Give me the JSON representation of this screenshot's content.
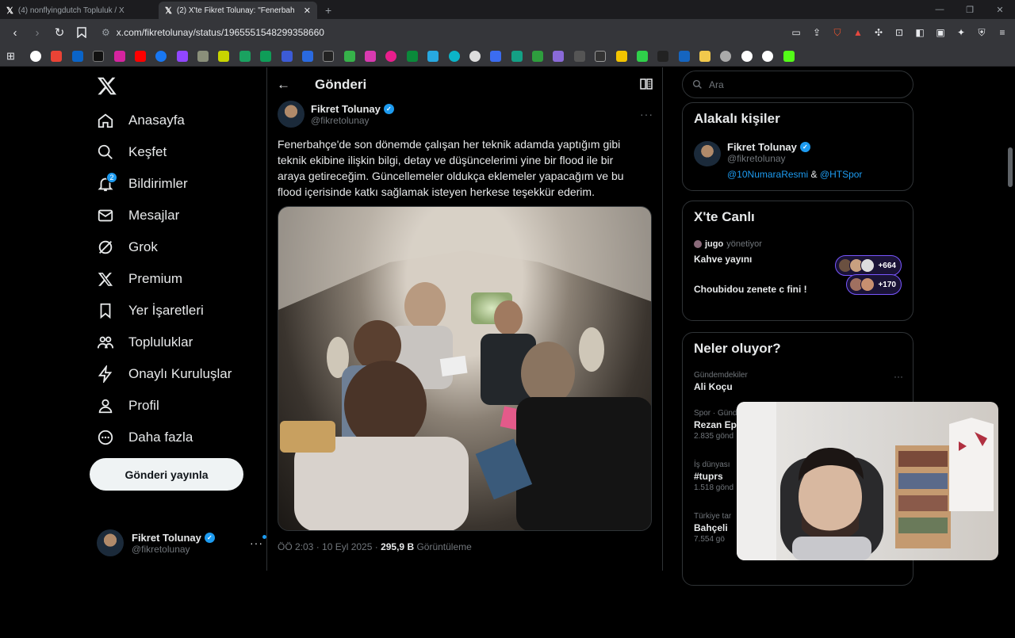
{
  "browser": {
    "tabs": [
      {
        "label": "(4) nonflyingdutch Topluluk / X",
        "active": false
      },
      {
        "label": "(2) X'te Fikret Tolunay: \"Fenerbah",
        "active": true
      }
    ],
    "url": "x.com/fikretolunay/status/1965551548299358660"
  },
  "bookmarks": [
    "google-icon",
    "gmail-icon",
    "outlook-icon",
    "x-icon",
    "instagram-icon",
    "youtube-icon",
    "facebook-icon",
    "twitch-icon",
    "app-icon",
    "app-icon",
    "app-icon",
    "sheets-icon",
    "app-icon",
    "app-icon",
    "app-icon",
    "app-icon",
    "app-icon",
    "app-icon",
    "app-icon",
    "app-icon",
    "app-icon",
    "app-icon",
    "app-icon",
    "app-icon",
    "app-icon",
    "app-icon",
    "app-icon",
    "app-icon",
    "app-icon",
    "app-icon",
    "app-icon",
    "app-icon",
    "app-icon",
    "app-icon",
    "app-icon",
    "folder-icon",
    "link-icon",
    "google-icon",
    "google-icon",
    "kick-icon"
  ],
  "nav": {
    "items": [
      {
        "label": "Anasayfa",
        "icon": "home-icon"
      },
      {
        "label": "Keşfet",
        "icon": "search-icon"
      },
      {
        "label": "Bildirimler",
        "icon": "bell-icon",
        "badge": "2"
      },
      {
        "label": "Mesajlar",
        "icon": "mail-icon"
      },
      {
        "label": "Grok",
        "icon": "grok-icon"
      },
      {
        "label": "Premium",
        "icon": "x-icon"
      },
      {
        "label": "Yer İşaretleri",
        "icon": "bookmark-icon"
      },
      {
        "label": "Topluluklar",
        "icon": "people-icon"
      },
      {
        "label": "Onaylı Kuruluşlar",
        "icon": "bolt-icon"
      },
      {
        "label": "Profil",
        "icon": "person-icon"
      },
      {
        "label": "Daha fazla",
        "icon": "more-circle-icon"
      }
    ],
    "post_button": "Gönderi yayınla",
    "account": {
      "name": "Fikret Tolunay",
      "handle": "@fikretolunay"
    }
  },
  "main": {
    "title": "Gönderi",
    "tweet": {
      "author": "Fikret Tolunay",
      "handle": "@fikretolunay",
      "text": "Fenerbahçe'de son dönemde çalışan her teknik adamda yaptığım gibi teknik ekibine ilişkin bilgi, detay ve düşüncelerimi yine bir flood ile bir araya getireceğim. Güncellemeler oldukça eklemeler yapacağım ve bu flood içerisinde katkı sağlamak isteyen herkese teşekkür ederim.",
      "time": "ÖÖ 2:03 · 10 Eyl 2025 · ",
      "views": "295,9 B",
      "views_label": " Görüntüleme"
    }
  },
  "right": {
    "search_placeholder": "Ara",
    "related": {
      "title": "Alakalı kişiler",
      "name": "Fikret Tolunay",
      "handle": "@fikretolunay",
      "mention1": "@10NumaraResmi",
      "amp": " & ",
      "mention2": "@HTSpor"
    },
    "live": {
      "title": "X'te Canlı",
      "host": "jugo",
      "host_suffix": "yönetiyor",
      "space1": "Kahve yayını",
      "count1": "+664",
      "space2": "Choubidou zenete c fini !",
      "count2": "+170"
    },
    "trends": {
      "title": "Neler oluyor?",
      "items": [
        {
          "context": "Gündemdekiler",
          "name": "Ali Koçu",
          "count": ""
        },
        {
          "context": "Spor · Günd",
          "name": "Rezan Ep",
          "count": "2.835 gönd"
        },
        {
          "context": "İş dünyası",
          "name": "#tuprs",
          "count": "1.518 gönd"
        },
        {
          "context": "Türkiye tar",
          "name": "Bahçeli",
          "count": "7.554 gö"
        }
      ]
    }
  }
}
